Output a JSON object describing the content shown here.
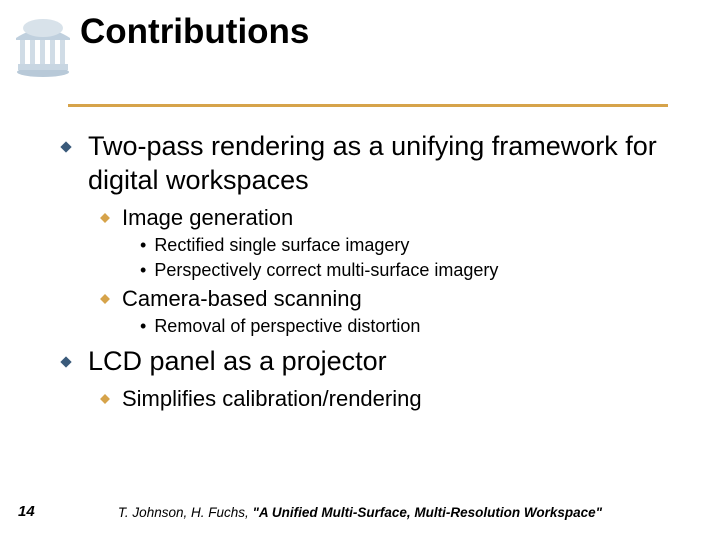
{
  "header": {
    "title": "Contributions"
  },
  "content": {
    "items": [
      {
        "text": "Two-pass rendering as a unifying framework for digital workspaces",
        "children": [
          {
            "text": "Image generation",
            "children": [
              {
                "text": "Rectified single surface imagery"
              },
              {
                "text": "Perspectively correct multi-surface imagery"
              }
            ]
          },
          {
            "text": "Camera-based scanning",
            "children": [
              {
                "text": "Removal of perspective distortion"
              }
            ]
          }
        ]
      },
      {
        "text": "LCD panel as a projector",
        "children": [
          {
            "text": "Simplifies calibration/rendering"
          }
        ]
      }
    ]
  },
  "footer": {
    "page_number": "14",
    "authors": "T. Johnson, H. Fuchs, ",
    "paper_title": "\"A Unified Multi-Surface, Multi-Resolution Workspace\""
  },
  "colors": {
    "accent_orange": "#d6a34a",
    "band_blue": "#7aa8d6"
  }
}
